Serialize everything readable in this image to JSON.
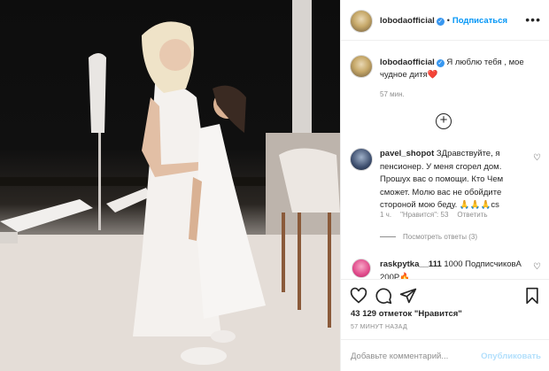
{
  "post_header": {
    "username": "lobodaofficial",
    "separator": "•",
    "follow_label": "Подписаться",
    "more_label": "•••"
  },
  "caption": {
    "username": "lobodaofficial",
    "text": "Я люблю тебя , мое чудное дитя",
    "emoji": "❤️",
    "time": "57 мин."
  },
  "load_more_label": "+",
  "comments": [
    {
      "username": "pavel_shopot",
      "text": "ЗДравствуйте, я пенсионер. У меня сгорел дом. Прошух вас о помощи. Кто Чем сможет. Молю вас не обойдите стороной мою беду. 🙏🙏🙏cs",
      "time": "1 ч.",
      "likes": "\"Нравится\": 53",
      "reply_label": "Ответить",
      "view_replies": "Посмотреть ответы (3)"
    },
    {
      "username": "raskpytka__111",
      "text": "1000 ПодписчиковА 200Р🔥"
    }
  ],
  "actions": {
    "likes_text": "43 129 отметок \"Нравится\"",
    "time_ago": "57 МИНУТ НАЗАД"
  },
  "add_comment": {
    "placeholder": "Добавьте комментарий...",
    "post_label": "Опубликовать"
  },
  "icons": {
    "like": "heart-icon",
    "comment": "comment-icon",
    "share": "paper-plane-icon",
    "save": "bookmark-icon"
  }
}
